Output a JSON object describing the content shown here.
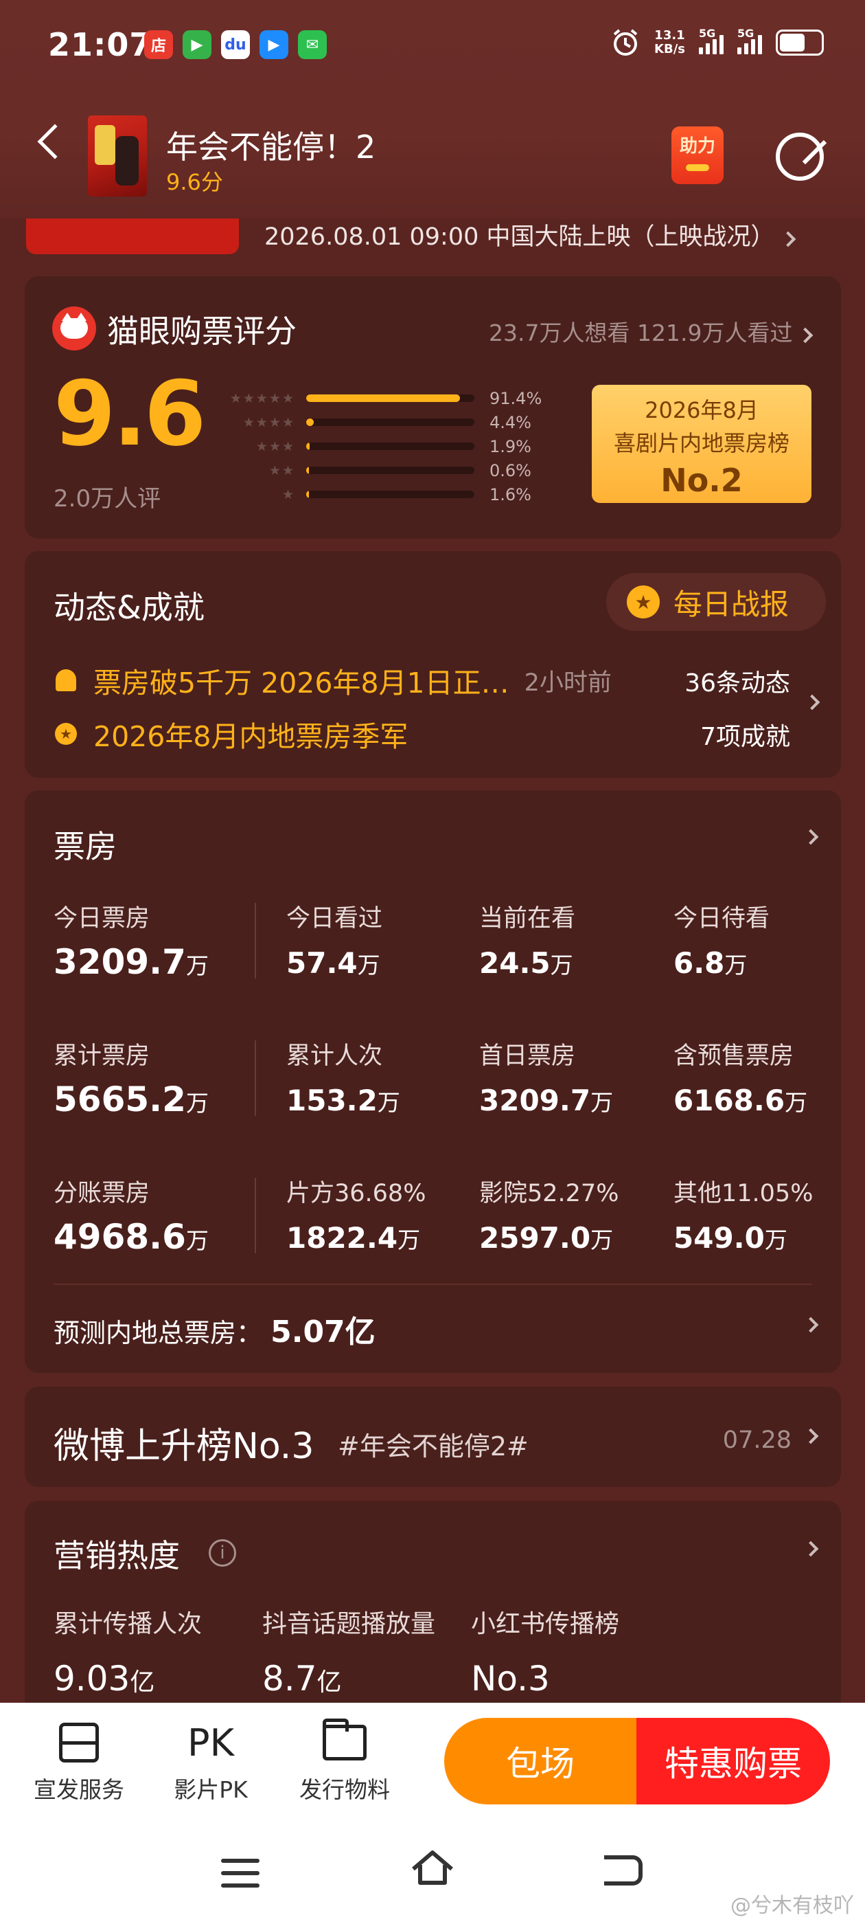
{
  "status_bar": {
    "time": "21:07",
    "net_speed_value": "13.1",
    "net_speed_unit": "KB/s",
    "signal_1": "5G",
    "signal_2": "5G",
    "apps": [
      "店",
      "▶",
      "du",
      "▶",
      "✉"
    ]
  },
  "header": {
    "title": "年会不能停！2",
    "score": "9.6分",
    "help_label": "助力"
  },
  "release": {
    "text": "2026.08.01 09:00 中国大陆上映（上映战况）"
  },
  "rating": {
    "title": "猫眼购票评分",
    "want_seen": "23.7万人想看 121.9万人看过",
    "score": "9.6",
    "people": "2.0万人评",
    "distribution": [
      {
        "stars": "★★★★★",
        "pct_label": "91.4%",
        "pct": 91.4
      },
      {
        "stars": "★★★★",
        "pct_label": "4.4%",
        "pct": 4.4
      },
      {
        "stars": "★★★",
        "pct_label": "1.9%",
        "pct": 1.9
      },
      {
        "stars": "★★",
        "pct_label": "0.6%",
        "pct": 0.6
      },
      {
        "stars": "★",
        "pct_label": "1.6%",
        "pct": 1.6
      }
    ],
    "badge": {
      "line1": "2026年8月",
      "line2": "喜剧片内地票房榜",
      "line3": "No.2"
    }
  },
  "news": {
    "title": "动态&成就",
    "daily_btn": "每日战报",
    "row1_text": "票房破5千万 2026年8月1日正…",
    "row1_time": "2小时前",
    "row1_count": "36条动态",
    "row2_text": "2026年8月内地票房季军",
    "row2_count": "7项成就"
  },
  "box_office": {
    "title": "票房",
    "stats": [
      {
        "label": "今日票房",
        "value": "3209.7",
        "unit": "万"
      },
      {
        "label": "今日看过",
        "value": "57.4",
        "unit": "万"
      },
      {
        "label": "当前在看",
        "value": "24.5",
        "unit": "万"
      },
      {
        "label": "今日待看",
        "value": "6.8",
        "unit": "万"
      },
      {
        "label": "累计票房",
        "value": "5665.2",
        "unit": "万"
      },
      {
        "label": "累计人次",
        "value": "153.2",
        "unit": "万"
      },
      {
        "label": "首日票房",
        "value": "3209.7",
        "unit": "万"
      },
      {
        "label": "含预售票房",
        "value": "6168.6",
        "unit": "万"
      },
      {
        "label": "分账票房",
        "value": "4968.6",
        "unit": "万"
      },
      {
        "label": "片方36.68%",
        "value": "1822.4",
        "unit": "万"
      },
      {
        "label": "影院52.27%",
        "value": "2597.0",
        "unit": "万"
      },
      {
        "label": "其他11.05%",
        "value": "549.0",
        "unit": "万"
      }
    ],
    "predict_label": "预测内地总票房：",
    "predict_value": "5.07亿"
  },
  "weibo": {
    "title": "微博上升榜No.3",
    "tag": "#年会不能停2#",
    "date": "07.28"
  },
  "marketing": {
    "title": "营销热度",
    "items": [
      {
        "label": "累计传播人次",
        "value": "9.03",
        "unit": "亿"
      },
      {
        "label": "抖音话题播放量",
        "value": "8.7",
        "unit": "亿"
      },
      {
        "label": "小红书传播榜",
        "value": "No.3",
        "unit": ""
      }
    ]
  },
  "bottom_bar": {
    "tools": [
      {
        "label": "宣发服务",
        "icon": "server-icon"
      },
      {
        "label": "影片PK",
        "icon": "pk-icon",
        "icon_text": "PK"
      },
      {
        "label": "发行物料",
        "icon": "folder-icon"
      }
    ],
    "btn_baochang": "包场",
    "btn_buy": "特惠购票"
  },
  "watermark": "@兮木有枝吖",
  "colors": {
    "accent": "#ffb21a",
    "background": "#5a2521",
    "card": "#4a201c",
    "buy": "#ff1f1f",
    "baochang": "#ff8c00"
  }
}
